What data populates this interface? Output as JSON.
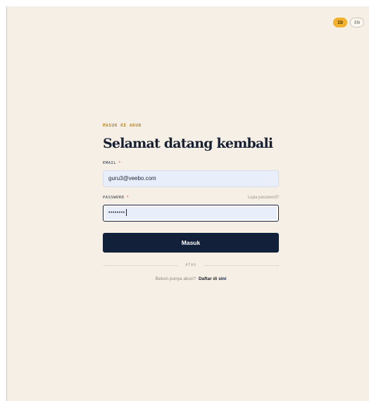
{
  "lang_switch": {
    "options": [
      {
        "label": "ID",
        "active": true
      },
      {
        "label": "EN",
        "active": false
      }
    ]
  },
  "form": {
    "eyebrow": "MASUK KE AKUN",
    "title": "Selamat datang kembali",
    "email_label": "EMAIL",
    "email_required": "*",
    "email_value": "guru3@veebo.com",
    "password_label": "PASSWORD",
    "password_required": "*",
    "forgot_link": "Lupa password?",
    "password_masked": "••••••••",
    "submit_label": "Masuk",
    "divider_text": "ATAU",
    "signup_prompt": "Belum punya akun?",
    "signup_link": "Daftar di sini"
  },
  "colors": {
    "background": "#f6efe6",
    "accent": "#f2b12d",
    "primary": "#13203a",
    "required": "#e0473a"
  }
}
